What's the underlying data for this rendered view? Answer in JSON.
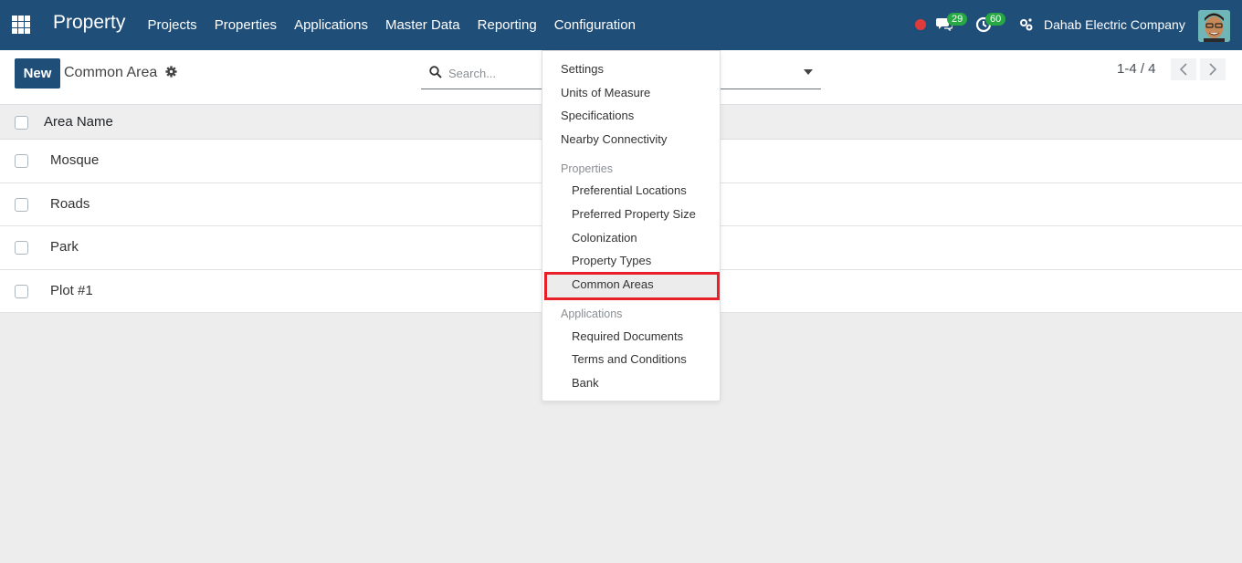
{
  "navbar": {
    "brand": "Property",
    "menu": [
      "Projects",
      "Properties",
      "Applications",
      "Master Data",
      "Reporting",
      "Configuration"
    ],
    "messages_count": "29",
    "activities_count": "60",
    "company": "Dahab Electric Company",
    "colors": {
      "bar": "#1f4e79",
      "badge": "#28a745",
      "record": "#e03b3b"
    }
  },
  "control_panel": {
    "new_label": "New",
    "breadcrumb": "Common Area",
    "search_placeholder": "Search...",
    "pager": "1-4 / 4"
  },
  "list": {
    "column": "Area Name",
    "rows": [
      "Mosque",
      "Roads",
      "Park",
      "Plot #1"
    ]
  },
  "dropdown": {
    "top_items": [
      "Settings",
      "Units of Measure",
      "Specifications",
      "Nearby Connectivity"
    ],
    "properties_header": "Properties",
    "properties_items": [
      "Preferential Locations",
      "Preferred Property Size",
      "Colonization",
      "Property Types",
      "Common Areas"
    ],
    "applications_header": "Applications",
    "applications_items": [
      "Required Documents",
      "Terms and Conditions",
      "Bank"
    ],
    "highlight_color": "#e8202a"
  }
}
